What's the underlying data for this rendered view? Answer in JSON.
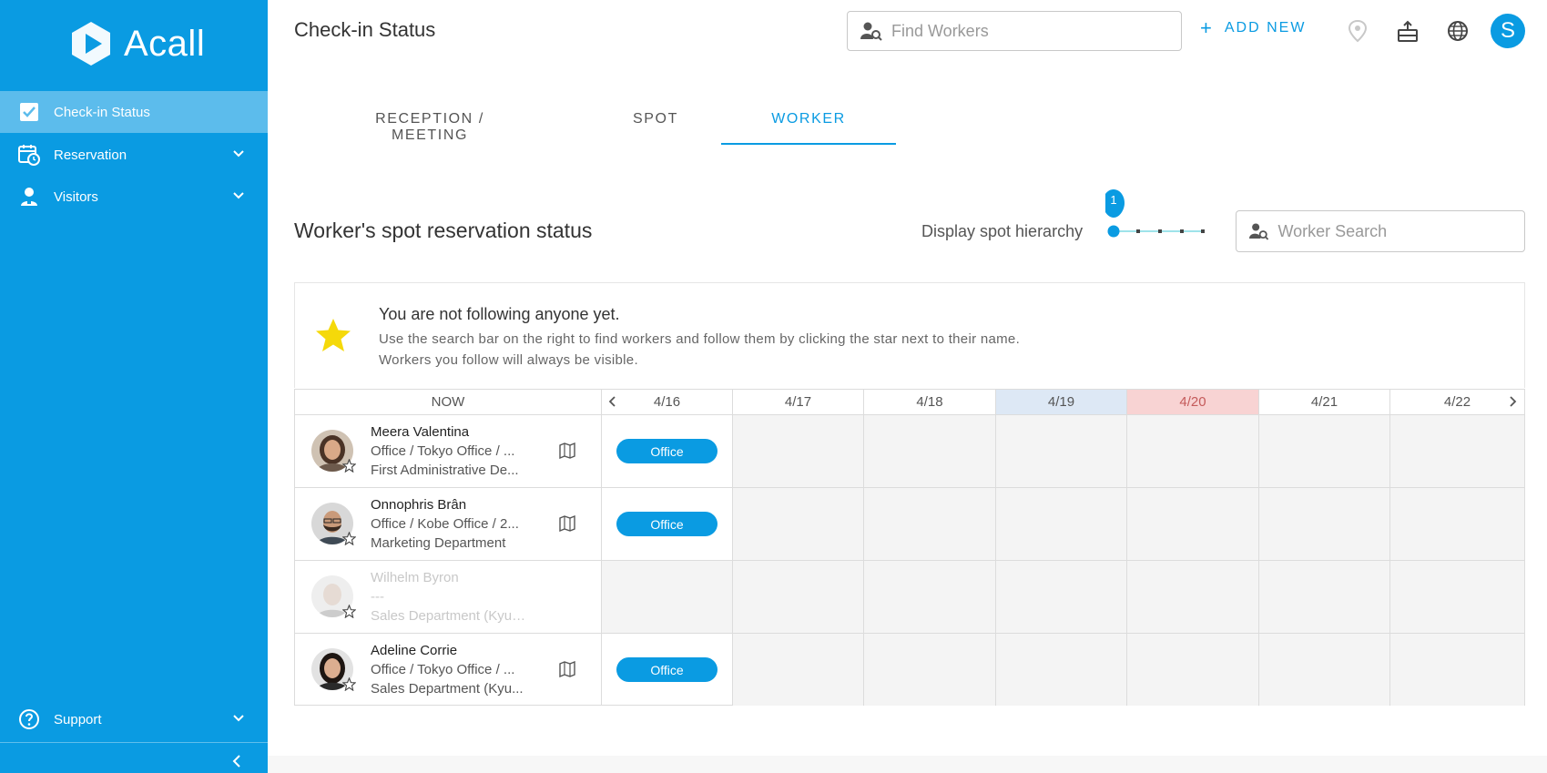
{
  "app": {
    "brand": "Acall",
    "page_title": "Check-in Status",
    "colors": {
      "primary": "#0a9be2",
      "sidebar_active": "#5cbcec",
      "today_bg": "#dde8f5",
      "holiday_bg": "#f8d3d3",
      "star": "#f5d90a"
    }
  },
  "sidebar": {
    "items": [
      {
        "label": "Check-in Status",
        "icon": "checkbox-icon",
        "active": true
      },
      {
        "label": "Reservation",
        "icon": "calendar-clock-icon"
      },
      {
        "label": "Visitors",
        "icon": "visitor-icon"
      }
    ],
    "support_label": "Support"
  },
  "header": {
    "search_placeholder": "Find Workers",
    "add_new_label": "ADD NEW"
  },
  "tabs": [
    {
      "label": "RECEPTION / MEETING"
    },
    {
      "label": "SPOT"
    },
    {
      "label": "WORKER",
      "active": true
    }
  ],
  "section": {
    "title": "Worker's spot reservation status",
    "hierarchy_label": "Display spot hierarchy",
    "hierarchy_level": "1",
    "worker_search_placeholder": "Worker Search"
  },
  "notice": {
    "title": "You are not following anyone yet.",
    "line1": "Use the search bar on the right to find workers and follow them by clicking the star next to their name.",
    "line2": "Workers you follow will always be visible."
  },
  "table": {
    "now_label": "NOW",
    "dates": [
      "4/16",
      "4/17",
      "4/18",
      "4/19",
      "4/20",
      "4/21",
      "4/22"
    ],
    "workers": [
      {
        "name": "Meera Valentina",
        "location": "Office / Tokyo Office / ...",
        "department": "First Administrative De...",
        "status": "Office"
      },
      {
        "name": "Onnophris Brân",
        "location": "Office / Kobe Office / 2...",
        "department": "Marketing Department",
        "status": "Office"
      },
      {
        "name": "Wilhelm Byron",
        "location": "---",
        "department": "Sales Department (Kyush...",
        "status": ""
      },
      {
        "name": "Adeline Corrie",
        "location": "Office / Tokyo Office / ...",
        "department": "Sales Department (Kyu...",
        "status": "Office"
      }
    ]
  },
  "user": {
    "initial": "S"
  }
}
